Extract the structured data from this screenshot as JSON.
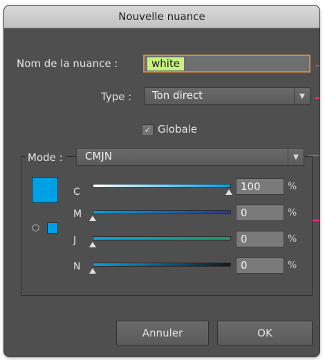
{
  "dialog": {
    "title": "Nouvelle nuance",
    "name_label": "Nom de la nuance :",
    "name_value": "white",
    "type_label": "Type :",
    "type_value": "Ton direct",
    "global_label": "Globale",
    "global_checked": true,
    "mode_label": "Mode :",
    "mode_value": "CMJN",
    "swatch_color": "#00a0e6",
    "sliders": [
      {
        "label": "C",
        "value": "100",
        "unit": "%",
        "level": 1.0
      },
      {
        "label": "M",
        "value": "0",
        "unit": "%",
        "level": 0.0
      },
      {
        "label": "J",
        "value": "0",
        "unit": "%",
        "level": 0.0
      },
      {
        "label": "N",
        "value": "0",
        "unit": "%",
        "level": 0.0
      }
    ],
    "cancel_label": "Annuler",
    "ok_label": "OK"
  },
  "icons": {
    "dropdown_arrow": "dropdown-arrow-icon",
    "gamut": "cube-icon",
    "check": "checkmark-icon"
  },
  "colors": {
    "name_highlight": "#c9f27a",
    "focus_ring": "#d98a3a",
    "annotation": "#ef2f8a"
  }
}
